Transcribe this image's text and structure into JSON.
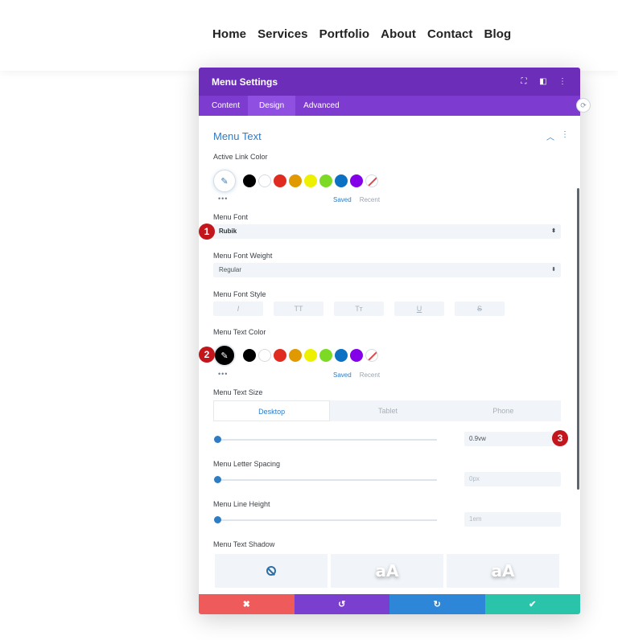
{
  "site_nav": {
    "items": [
      "Home",
      "Services",
      "Portfolio",
      "About",
      "Contact",
      "Blog"
    ]
  },
  "modal": {
    "title": "Menu Settings",
    "header_icons": [
      "expand-icon",
      "split-view-icon",
      "more-vertical-icon"
    ],
    "tabs": [
      "Content",
      "Design",
      "Advanced"
    ],
    "active_tab": "Design"
  },
  "section": {
    "title": "Menu Text"
  },
  "active_link_color": {
    "label": "Active Link Color",
    "saved_label": "Saved",
    "recent_label": "Recent"
  },
  "swatch_colors": [
    "#000000",
    "#ffffff",
    "#e02b20",
    "#e09900",
    "#edf000",
    "#7cda24",
    "#0c71c3",
    "#8300e9"
  ],
  "menu_font": {
    "label": "Menu Font",
    "value": "Rubik"
  },
  "menu_font_weight": {
    "label": "Menu Font Weight",
    "value": "Regular"
  },
  "menu_font_style": {
    "label": "Menu Font Style",
    "buttons": [
      "I",
      "TT",
      "Tт",
      "U",
      "S"
    ]
  },
  "menu_text_color": {
    "label": "Menu Text Color",
    "saved_label": "Saved",
    "recent_label": "Recent"
  },
  "menu_text_size": {
    "label": "Menu Text Size",
    "device_tabs": [
      "Desktop",
      "Tablet",
      "Phone"
    ],
    "value": "0.9vw"
  },
  "menu_letter_spacing": {
    "label": "Menu Letter Spacing",
    "value": "0px"
  },
  "menu_line_height": {
    "label": "Menu Line Height",
    "value": "1em"
  },
  "menu_text_shadow": {
    "label": "Menu Text Shadow",
    "preview_text": "aA"
  },
  "footer": {
    "buttons": [
      {
        "icon": "close-icon",
        "glyph": "✖",
        "color": "#ef5b5b"
      },
      {
        "icon": "undo-icon",
        "glyph": "↺",
        "color": "#7b3fd0"
      },
      {
        "icon": "redo-icon",
        "glyph": "↻",
        "color": "#2e86d9"
      },
      {
        "icon": "check-icon",
        "glyph": "✔",
        "color": "#29c4a9"
      }
    ]
  },
  "markers": [
    "1",
    "2",
    "3"
  ],
  "colors": {
    "header_bg": "#6c2eb9",
    "tabs_bg": "#7e3bd0",
    "accent_blue": "#2e7cc4",
    "marker_red": "#c3151c"
  }
}
